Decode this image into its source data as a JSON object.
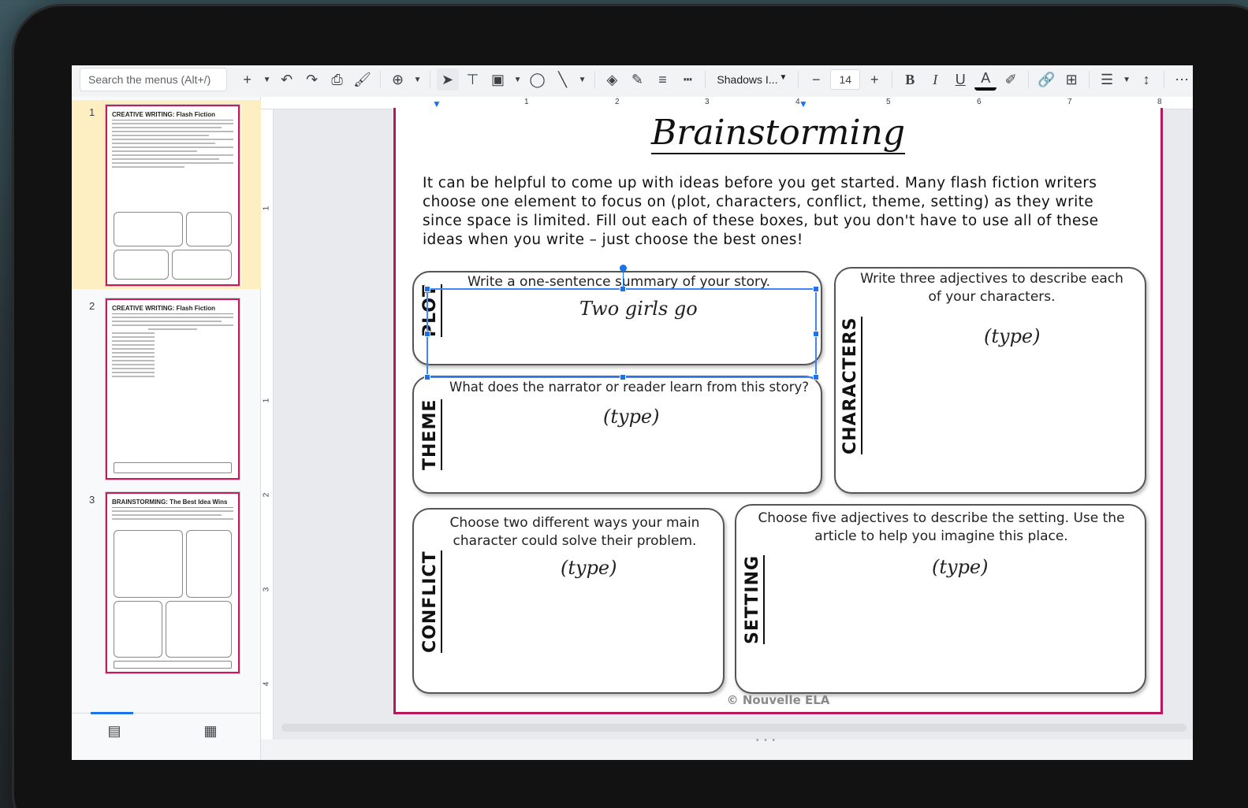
{
  "toolbar": {
    "search_placeholder": "Search the menus (Alt+/)",
    "font_name": "Shadows I...",
    "font_size": "14",
    "bold": "B",
    "italic": "I",
    "underline": "U",
    "text_color": "A"
  },
  "filmstrip": {
    "slides": [
      {
        "number": "1",
        "title": "CREATIVE WRITING: Flash Fiction"
      },
      {
        "number": "2",
        "title": "CREATIVE WRITING: Flash Fiction"
      },
      {
        "number": "3",
        "title": "BRAINSTORMING: The Best Idea Wins"
      }
    ],
    "selected": 1
  },
  "ruler": {
    "top_marks": [
      "1",
      "2",
      "3",
      "4",
      "5",
      "6",
      "7",
      "8"
    ],
    "left_marks": [
      "1",
      "1",
      "2",
      "3",
      "4"
    ]
  },
  "slide": {
    "title": "Brainstorming",
    "intro": "It can be helpful to come up with ideas before you get started. Many flash fiction writers choose one element to focus on (plot, characters, conflict, theme, setting) as they write since space is limited. Fill out each of these boxes, but you don't have to use all of these ideas when you write – just choose the best ones!",
    "cards": {
      "plot": {
        "tag": "PLOT",
        "prompt": "Write a one-sentence summary of your story.",
        "answer": "Two girls go"
      },
      "characters": {
        "tag": "CHARACTERS",
        "prompt": "Write three adjectives to describe each of your characters.",
        "answer": "(type)"
      },
      "theme": {
        "tag": "THEME",
        "prompt": "What does the narrator or reader learn from this story?",
        "answer": "(type)"
      },
      "conflict": {
        "tag": "CONFLICT",
        "prompt": "Choose two different ways your main character could solve their problem.",
        "answer": "(type)"
      },
      "setting": {
        "tag": "SETTING",
        "prompt": "Choose five adjectives to describe the setting. Use the article to help you imagine this place.",
        "answer": "(type)"
      }
    },
    "credit": "© Nouvelle ELA"
  },
  "colors": {
    "slide_border": "#b8185a",
    "selection": "#4285f4",
    "filmstrip_selected": "#feefc3"
  }
}
